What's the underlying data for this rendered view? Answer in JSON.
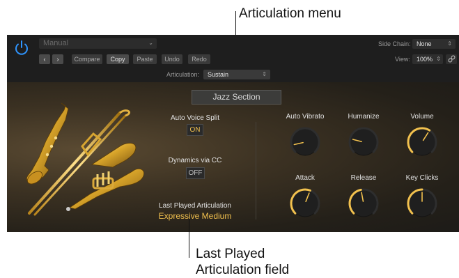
{
  "callouts": {
    "articulation_menu": "Articulation menu",
    "last_played_line1": "Last Played",
    "last_played_line2": "Articulation field"
  },
  "header": {
    "preset": "Manual",
    "compare": "Compare",
    "copy": "Copy",
    "paste": "Paste",
    "undo": "Undo",
    "redo": "Redo",
    "articulation_label": "Articulation:",
    "articulation_value": "Sustain",
    "side_chain_label": "Side Chain:",
    "side_chain_value": "None",
    "view_label": "View:",
    "view_value": "100%"
  },
  "panel": {
    "preset_name": "Jazz Section",
    "auto_voice_split_label": "Auto Voice Split",
    "auto_voice_split_value": "ON",
    "dynamics_label": "Dynamics via CC",
    "dynamics_value": "OFF",
    "last_played_label": "Last Played Articulation",
    "last_played_value": "Expressive Medium"
  },
  "knobs": [
    {
      "label": "Auto Vibrato",
      "level": 0.12,
      "active": false
    },
    {
      "label": "Humanize",
      "level": 0.22,
      "active": false
    },
    {
      "label": "Volume",
      "level": 0.62,
      "active": true
    },
    {
      "label": "Attack",
      "level": 0.58,
      "active": true
    },
    {
      "label": "Release",
      "level": 0.46,
      "active": true
    },
    {
      "label": "Key Clicks",
      "level": 0.5,
      "active": true
    }
  ],
  "colors": {
    "accent_gold": "#f2c14e",
    "track_dark": "#1f1f1f",
    "power_blue": "#2f95ff"
  }
}
